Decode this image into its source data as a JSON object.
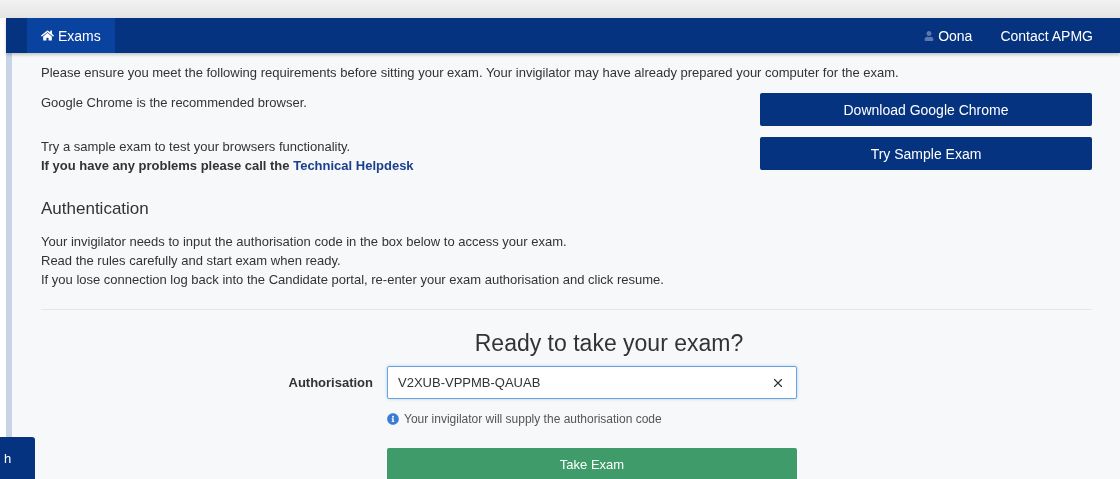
{
  "nav": {
    "home": {
      "label": "Exams",
      "selected": true
    },
    "user": "Oona",
    "contact": "Contact APMG"
  },
  "intro": "Please ensure you meet the following requirements before sitting your exam. Your invigilator may have already prepared your computer for the exam.",
  "browser_note": "Google Chrome is the recommended browser.",
  "sample_note": "Try a sample exam to test your browsers functionality.",
  "problems_note": "If you have any problems please call the",
  "helpdesk_link": "Technical Helpdesk",
  "buttons": [
    "Download Google Chrome",
    "Try Sample Exam"
  ],
  "authentication": {
    "heading": "Authentication",
    "lines": [
      "Your invigilator needs to input the authorisation code in the box below to access your exam.",
      "Read the rules carefully and start exam when ready.",
      "If you lose connection log back into the Candidate portal, re-enter your exam authorisation and click resume."
    ]
  },
  "form": {
    "heading": "Ready to take your exam?",
    "label": "Authorisation",
    "value": "V2XUB-VPPMB-QAUAB",
    "help": "Your invigilator will supply the authorisation code",
    "submit": "Take Exam"
  },
  "side_tab": "h"
}
